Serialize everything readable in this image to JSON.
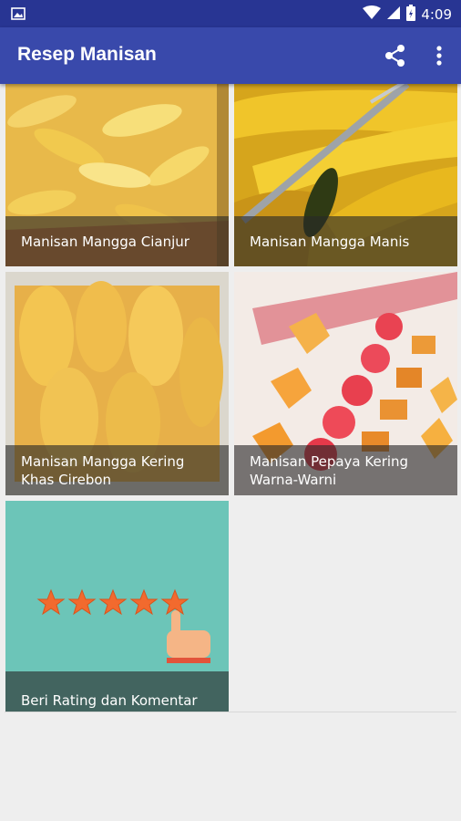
{
  "status_bar": {
    "time": "4:09",
    "icons": [
      "gallery-icon",
      "wifi-icon",
      "signal-icon",
      "battery-icon"
    ]
  },
  "app_bar": {
    "title": "Resep Manisan",
    "actions": [
      "share-icon",
      "more-vert-icon"
    ]
  },
  "recipes": [
    {
      "title": "Manisan Mangga Cianjur"
    },
    {
      "title": "Manisan Mangga Manis"
    },
    {
      "title": "Manisan Mangga Kering Khas Cirebon"
    },
    {
      "title": "Manisan Pepaya Kering Warna-Warni"
    },
    {
      "title": "Beri Rating dan Komentar"
    }
  ],
  "colors": {
    "status_bar": "#283593",
    "app_bar": "#3949ab",
    "rating_bg": "#6cc5b8",
    "star": "#f26a2e"
  }
}
